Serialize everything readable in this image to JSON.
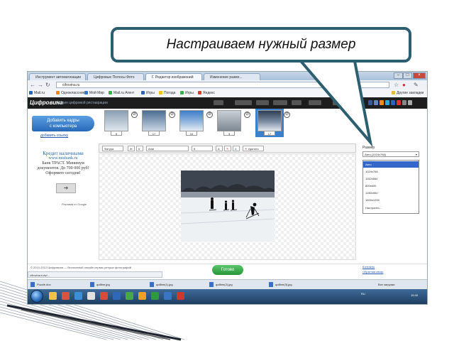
{
  "callout": {
    "text": "Настраиваем нужный размер"
  },
  "browser": {
    "tabs": [
      "Инструмент автоматизации",
      "Цифровые Полосы Фото",
      "Г. Редактор изображений",
      "Изменение разме..."
    ],
    "url": "cifrovina.ru",
    "bookmarks": [
      "Mail.ru",
      "Одноклассники",
      "Мой Мир",
      "Mail.ru Агент",
      "Игры",
      "Погода",
      "Игры",
      "Яндекс"
    ],
    "bookmarks_right": "Другие закладки"
  },
  "site": {
    "logo": "Цифровина",
    "tagline": "Студия цифровой реставрации",
    "add_photo_label_line1": "Добавить кадры",
    "add_photo_label_line2": "с компьютера",
    "add_link": "добавить ссылку",
    "thumbnails": [
      {
        "count": "5"
      },
      {
        "count": "17"
      },
      {
        "count": "10"
      },
      {
        "count": "3"
      },
      {
        "count": "17"
      }
    ],
    "ad": {
      "title": "Кредит наличными",
      "url": "www.mtsbank.ru",
      "line1": "Банк ТРАСТ. Минимум",
      "line2": "документов. До 700 000 руб!",
      "line3": "Оформите сегодня!",
      "by": "Реклама от Google"
    },
    "toolbar": {
      "font_btn": "Фигура",
      "font_name": "Arial",
      "font_size": "8",
      "clear": "Удалить"
    },
    "right_panel": {
      "size_label": "Размер",
      "selected": "Авто (1024x768)",
      "options": [
        "Авто",
        "1024x768",
        "1152x864",
        "800x600",
        "1280x960",
        "1600x1200",
        "Настроить..."
      ]
    },
    "footer": {
      "text": "© 2010-2012 Цифровина — бесплатный онлайн сервис ретуши фотографий",
      "link1": "Контакты",
      "link2": "Обратная связь",
      "ready": "Готово"
    },
    "status": "cifrovina.ru/w/..."
  },
  "downloads": [
    "Puzzle.doc",
    "qo8bm.jpg",
    "qo8bm(1).jpg",
    "qo8bm(2).jpg",
    "qo8bm(3).jpg"
  ],
  "downloads_right": "Все загрузки",
  "taskbar": {
    "tray": "RU",
    "clock": "15:45"
  }
}
